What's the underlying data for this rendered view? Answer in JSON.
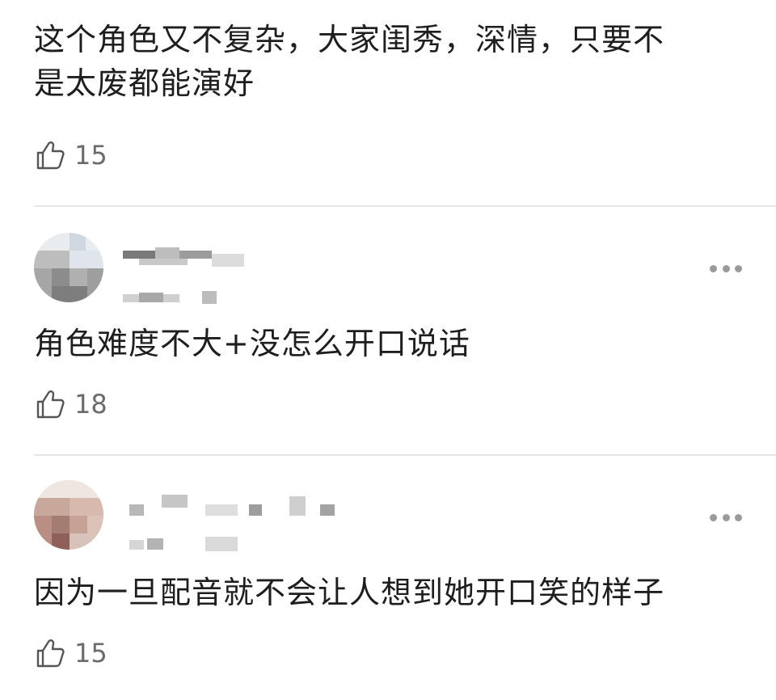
{
  "comments": [
    {
      "text_line1": "这个角色又不复杂，大家闺秀，深情，只要不",
      "text_line2": "是太废都能演好",
      "likes": "15",
      "icons": {
        "like": "thumbs-up-icon"
      }
    },
    {
      "text": "角色难度不大+没怎么开口说话",
      "likes": "18",
      "icons": {
        "like": "thumbs-up-icon",
        "more": "more-dots-icon"
      }
    },
    {
      "text": "因为一旦配音就不会让人想到她开口笑的样子",
      "likes": "15",
      "icons": {
        "like": "thumbs-up-icon",
        "more": "more-dots-icon"
      }
    }
  ],
  "colors": {
    "text": "#1e1e1e",
    "meta": "#6b6b6b",
    "divider": "#e6e6e6",
    "more_dots": "#9a9a9a"
  }
}
